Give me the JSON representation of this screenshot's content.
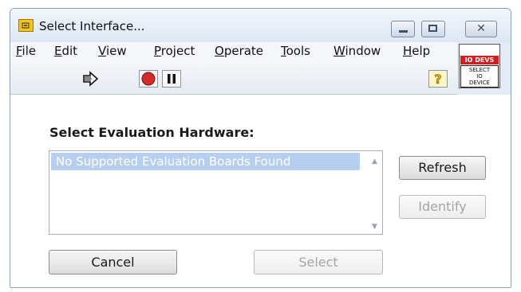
{
  "window": {
    "title": "Select Interface...",
    "close_glyph": "✕"
  },
  "menubar": {
    "items": [
      {
        "accel": "F",
        "rest": "ile"
      },
      {
        "accel": "E",
        "rest": "dit"
      },
      {
        "accel": "V",
        "rest": "iew"
      },
      {
        "accel": "P",
        "rest": "roject"
      },
      {
        "accel": "O",
        "rest": "perate"
      },
      {
        "accel": "T",
        "rest": "ools"
      },
      {
        "accel": "W",
        "rest": "indow"
      },
      {
        "accel": "H",
        "rest": "elp"
      }
    ]
  },
  "toolbar": {
    "icons": [
      "run-arrow-icon",
      "abort-stop-icon",
      "pause-icon",
      "context-help-icon"
    ],
    "help_glyph": "?"
  },
  "panel_icon": {
    "header": "IO DEVS",
    "line1": "SELECT",
    "line2": "IO",
    "line3": "DEVICE"
  },
  "content": {
    "heading": "Select Evaluation Hardware:",
    "list": {
      "items": [
        "No Supported Evaluation Boards Found"
      ],
      "selected_index": 0
    },
    "buttons": {
      "refresh": "Refresh",
      "identify": "Identify",
      "cancel": "Cancel",
      "select": "Select"
    }
  },
  "colors": {
    "window_chrome": "#e3ebf6",
    "selection": "#b6cff0",
    "stop_red": "#d42a2a",
    "panel_header_red": "#d81b1b",
    "disabled_text": "#a4a4a4"
  }
}
